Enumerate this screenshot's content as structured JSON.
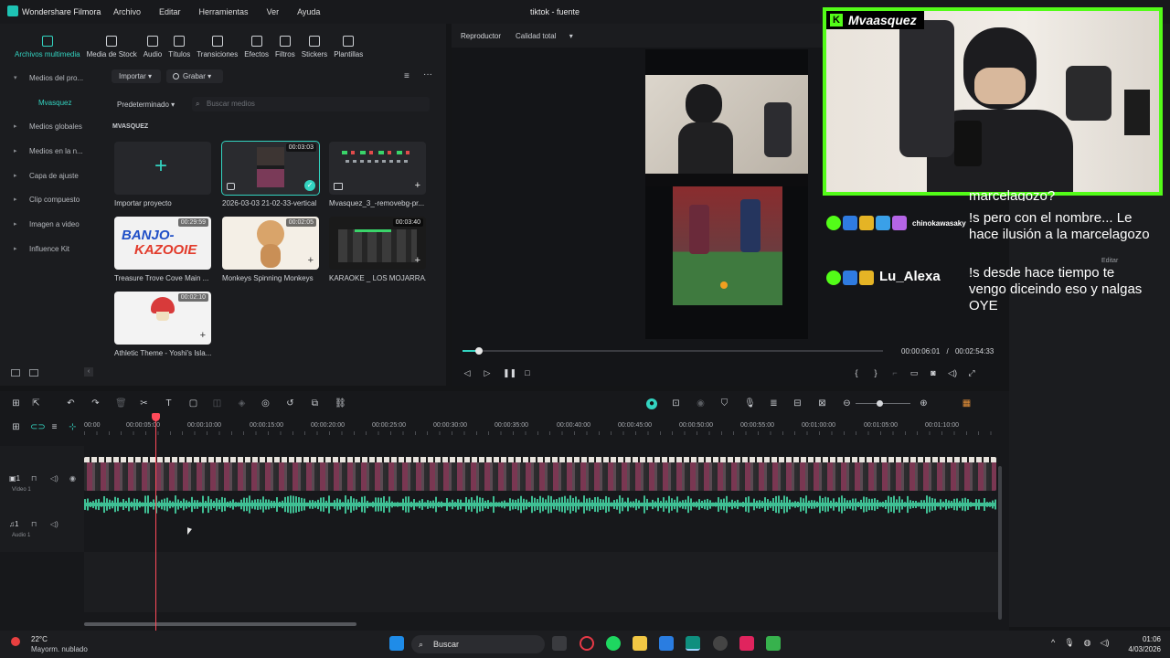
{
  "titlebar": {
    "app_name": "Wondershare Filmora",
    "menu": [
      "Archivo",
      "Editar",
      "Herramientas",
      "Ver",
      "Ayuda"
    ],
    "document_title": "tiktok - fuente"
  },
  "media_toolbar": [
    {
      "label": "Archivos multimedia",
      "icon": "media-files-icon",
      "active": true
    },
    {
      "label": "Media de Stock",
      "icon": "stock-media-icon"
    },
    {
      "label": "Audio",
      "icon": "audio-note-icon"
    },
    {
      "label": "Títulos",
      "icon": "titles-t-icon"
    },
    {
      "label": "Transiciones",
      "icon": "transitions-icon"
    },
    {
      "label": "Efectos",
      "icon": "effects-icon"
    },
    {
      "label": "Filtros",
      "icon": "filters-icon"
    },
    {
      "label": "Stickers",
      "icon": "stickers-icon"
    },
    {
      "label": "Plantillas",
      "icon": "templates-icon"
    }
  ],
  "sidebar": [
    {
      "label": "Medios del pro...",
      "expanded": true
    },
    {
      "label": "Mvasquez",
      "active": true
    },
    {
      "label": "Medios globales"
    },
    {
      "label": "Medios en la n..."
    },
    {
      "label": "Capa de ajuste"
    },
    {
      "label": "Clip compuesto"
    },
    {
      "label": "Imagen a video"
    },
    {
      "label": "Influence Kit"
    }
  ],
  "media_controls": {
    "import_label": "Importar",
    "record_label": "Grabar",
    "sort_label": "Predeterminado",
    "search_placeholder": "Buscar medios",
    "folder_label": "MVASQUEZ"
  },
  "media_items": [
    {
      "name": "Importar proyecto",
      "duration": "",
      "type": "import"
    },
    {
      "name": "2026-03-03 21-02-33-vertical",
      "duration": "00:03:03",
      "type": "video",
      "selected": true
    },
    {
      "name": "Mvasquez_3_-removebg-pr...",
      "duration": "",
      "type": "image"
    },
    {
      "name": "Treasure Trove Cove  Main ...",
      "duration": "00:29:59",
      "type": "video"
    },
    {
      "name": "Monkeys Spinning Monkeys",
      "duration": "00:02:05",
      "type": "video"
    },
    {
      "name": "KARAOKE _ LOS MOJARRA...",
      "duration": "00:03:40",
      "type": "video"
    },
    {
      "name": "Athletic Theme - Yoshi's Isla...",
      "duration": "00:02:10",
      "type": "video"
    }
  ],
  "player": {
    "label": "Reproductor",
    "quality": "Calidad total",
    "current_time": "00:00:06:01",
    "separator": "/",
    "total_time": "00:02:54:33",
    "progress": 0.04
  },
  "overlay": {
    "streamer_name": "Mvaasquez",
    "chat": [
      {
        "user": "",
        "message": "marcelagozo?"
      },
      {
        "user": "chinokawasaky",
        "message": "!s pero con el nombre... Le hace ilusión a la marcelagozo"
      },
      {
        "user": "Lu_Alexa",
        "message": "!s desde hace tiempo te vengo diceindo eso y nalgas OYE"
      }
    ]
  },
  "right_panel": {
    "edit_label": "Editar"
  },
  "timeline": {
    "ruler": [
      "00:00",
      "00:00:05:00",
      "00:00:10:00",
      "00:00:15:00",
      "00:00:20:00",
      "00:00:25:00",
      "00:00:30:00",
      "00:00:35:00",
      "00:00:40:00",
      "00:00:45:00",
      "00:00:50:00",
      "00:00:55:00",
      "00:01:00:00",
      "00:01:05:00",
      "00:01:10:00"
    ],
    "tracks": [
      {
        "id": "1",
        "name": "Vídeo 1"
      },
      {
        "id": "1",
        "name": "Audio 1"
      }
    ]
  },
  "taskbar": {
    "temperature": "22°C",
    "weather": "Mayorm. nublado",
    "search": "Buscar",
    "time": "01:06",
    "date": "4/03/2026"
  },
  "colors": {
    "accent": "#33d3c0",
    "kick_green": "#53fc18",
    "playhead": "#ff4a5a",
    "waveform": "#3fbf94"
  }
}
